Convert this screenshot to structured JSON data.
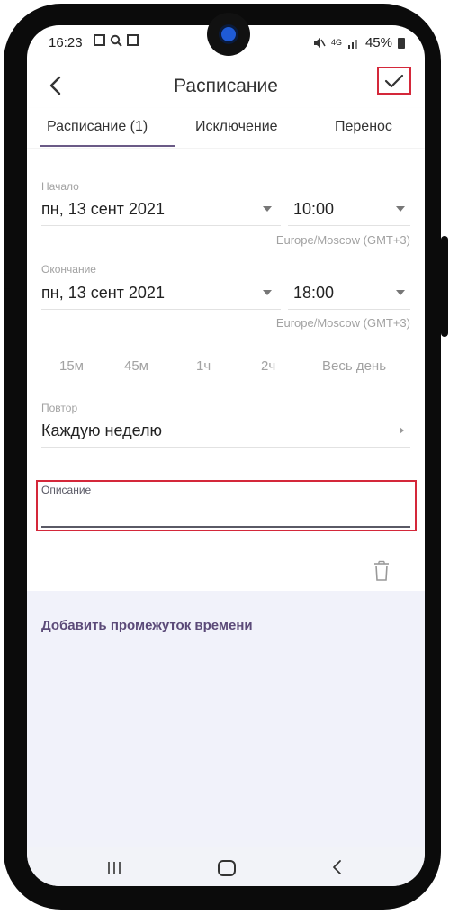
{
  "status_bar": {
    "time": "16:23",
    "network": "4G",
    "battery": "45%"
  },
  "app_bar": {
    "title": "Расписание"
  },
  "tabs": [
    {
      "label": "Расписание (1)",
      "selected": true
    },
    {
      "label": "Исключение",
      "selected": false
    },
    {
      "label": "Перенос",
      "selected": false
    }
  ],
  "start": {
    "label": "Начало",
    "date": "пн, 13 сент 2021",
    "time": "10:00",
    "timezone": "Europe/Moscow (GMT+3)"
  },
  "end": {
    "label": "Окончание",
    "date": "пн, 13 сент 2021",
    "time": "18:00",
    "timezone": "Europe/Moscow (GMT+3)"
  },
  "quick_durations": [
    "15м",
    "45м",
    "1ч",
    "2ч",
    "Весь день"
  ],
  "repeat": {
    "label": "Повтор",
    "value": "Каждую неделю"
  },
  "description": {
    "label": "Описание",
    "value": ""
  },
  "add_time_span_label": "Добавить промежуток времени",
  "colors": {
    "accent": "#6a5a86",
    "link": "#5b4a78",
    "highlight": "#d4283a",
    "lower_bg": "#f1f2fa"
  },
  "icons": {
    "back": "chevron-left-icon",
    "confirm": "check-icon",
    "delete": "trash-icon",
    "nav_recents": "recents-icon",
    "nav_home": "home-icon",
    "nav_back": "nav-back-icon"
  }
}
